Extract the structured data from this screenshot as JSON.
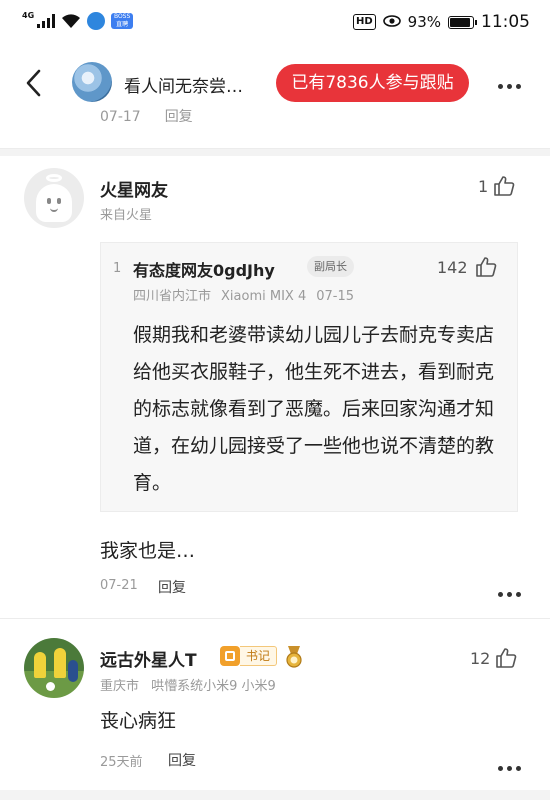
{
  "status_bar": {
    "signal_label": "4G",
    "app_badge": "BOSS直聘",
    "hd": "HD",
    "battery_percent": "93%",
    "battery_level": 0.93,
    "time": "11:05"
  },
  "header": {
    "title": "看人间无奈尝…",
    "join_label": "已有7836人参与跟贴"
  },
  "peek_row": {
    "time": "07-17",
    "reply": "回复"
  },
  "comments": [
    {
      "username": "火星网友",
      "location": "来自火星",
      "likes": "1",
      "quote": {
        "index": "1",
        "username": "有态度网友0gdJhy",
        "badge": "副局长",
        "likes": "142",
        "location": "四川省内江市",
        "device": "Xiaomi MIX 4",
        "date": "07-15",
        "text": "假期我和老婆带读幼儿园儿子去耐克专卖店给他买衣服鞋子，他生死不进去，看到耐克的标志就像看到了恶魔。后来回家沟通才知道，在幼儿园接受了一些他也说不清楚的教育。"
      },
      "text": "我家也是…",
      "time": "07-21",
      "reply": "回复"
    },
    {
      "username": "远古外星人T",
      "badge": "书记",
      "likes": "12",
      "location": "重庆市",
      "device": "哄懵系统小米9 小米9",
      "text": "丧心病狂",
      "time": "25天前",
      "reply": "回复"
    }
  ]
}
